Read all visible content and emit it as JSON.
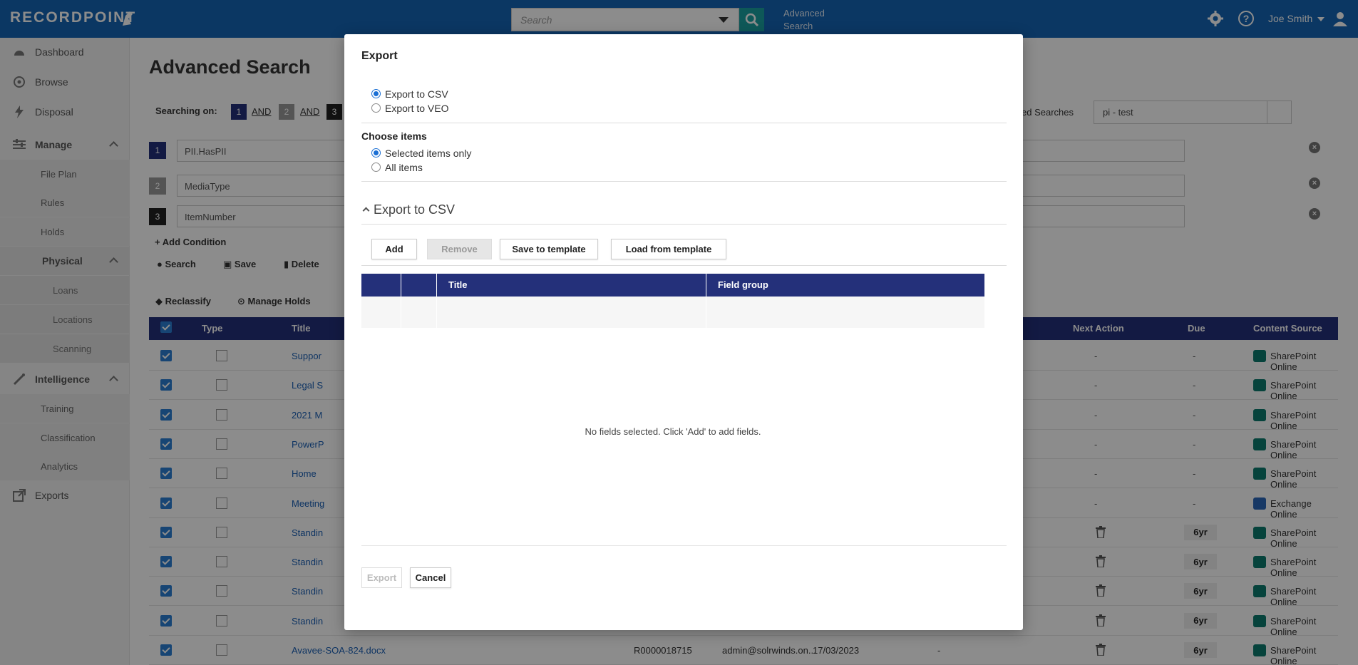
{
  "app": {
    "logo_text": "RECORDPOINT",
    "search_placeholder": "Search",
    "advanced_search_line1": "Advanced",
    "advanced_search_line2": "Search",
    "user_name": "Joe Smith"
  },
  "sidebar": {
    "items": [
      {
        "label": "Dashboard",
        "icon": "dashboard-icon"
      },
      {
        "label": "Browse",
        "icon": "compass-icon"
      },
      {
        "label": "Disposal",
        "icon": "bolt-icon"
      },
      {
        "label": "Manage",
        "icon": "sliders-icon"
      },
      {
        "label": "File Plan"
      },
      {
        "label": "Rules"
      },
      {
        "label": "Holds"
      },
      {
        "label": "Physical"
      },
      {
        "label": "Loans"
      },
      {
        "label": "Locations"
      },
      {
        "label": "Scanning"
      },
      {
        "label": "Intelligence",
        "icon": "wand-icon"
      },
      {
        "label": "Training"
      },
      {
        "label": "Classification"
      },
      {
        "label": "Analytics"
      },
      {
        "label": "Exports",
        "icon": "external-link-icon"
      }
    ]
  },
  "main": {
    "title": "Advanced Search",
    "searching_on": "Searching on:",
    "chips": [
      "1",
      "2",
      "3"
    ],
    "and_label": "AND",
    "saved_searches_label": "ed Searches",
    "saved_search_value": "pi - test",
    "conditions": [
      "PII.HasPII",
      "MediaType",
      "ItemNumber"
    ],
    "add_condition": "Add Condition",
    "actions": {
      "search": "Search",
      "save": "Save",
      "delete": "Delete"
    },
    "toolbar": {
      "reclassify": "Reclassify",
      "manage_holds": "Manage Holds"
    },
    "table": {
      "headers": {
        "type": "Type",
        "title": "Title",
        "next_action": "Next Action",
        "due": "Due",
        "content_source": "Content Source"
      },
      "rows": [
        {
          "title": "Suppor",
          "next": "-",
          "due": "-",
          "source": "SharePoint Online",
          "badge": false
        },
        {
          "title": "Legal S",
          "next": "-",
          "due": "-",
          "source": "SharePoint Online",
          "badge": false
        },
        {
          "title": "2021 M",
          "next": "-",
          "due": "-",
          "source": "SharePoint Online",
          "badge": false
        },
        {
          "title": "PowerP",
          "next": "-",
          "due": "-",
          "source": "SharePoint Online",
          "badge": false
        },
        {
          "title": "Home",
          "next": "-",
          "due": "-",
          "source": "SharePoint Online",
          "badge": false
        },
        {
          "title": "Meeting",
          "next": "-",
          "due": "-",
          "source": "Exchange Online",
          "badge": false
        },
        {
          "title": "Standin",
          "next": "",
          "due": "6yr",
          "source": "SharePoint Online",
          "badge": true
        },
        {
          "title": "Standin",
          "next": "",
          "due": "6yr",
          "source": "SharePoint Online",
          "badge": true
        },
        {
          "title": "Standin",
          "next": "",
          "due": "6yr",
          "source": "SharePoint Online",
          "badge": true
        },
        {
          "title": "Standin",
          "next": "",
          "due": "6yr",
          "source": "SharePoint Online",
          "badge": true
        },
        {
          "title": "Avavee-SOA-824.docx",
          "next": "",
          "due": "6yr",
          "source": "SharePoint Online",
          "badge": true,
          "item_number": "R0000018715",
          "author": "admin@solrwinds.on...",
          "date": "17/03/2023",
          "dash": "-"
        }
      ]
    }
  },
  "modal": {
    "title": "Export",
    "format_options": [
      {
        "label": "Export to CSV",
        "selected": true
      },
      {
        "label": "Export to VEO",
        "selected": false
      }
    ],
    "choose_items_label": "Choose items",
    "item_options": [
      {
        "label": "Selected items only",
        "selected": true
      },
      {
        "label": "All items",
        "selected": false
      }
    ],
    "section_title": "Export to CSV",
    "buttons": {
      "add": "Add",
      "remove": "Remove",
      "save_template": "Save to template",
      "load_template": "Load from template",
      "export": "Export",
      "cancel": "Cancel"
    },
    "table_headers": {
      "title": "Title",
      "field_group": "Field group"
    },
    "empty_message": "No fields selected. Click 'Add' to add fields."
  },
  "colors": {
    "topbar": "#1464b4",
    "table_header": "#24307a",
    "search_button": "#1aa0a0",
    "link": "#1a5fb4"
  }
}
